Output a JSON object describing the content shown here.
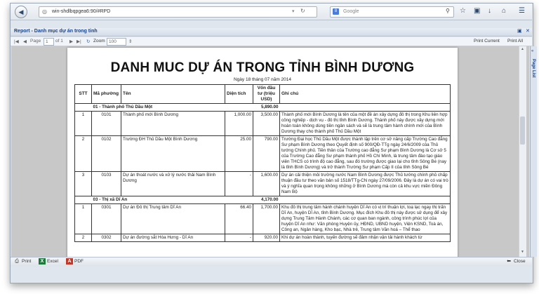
{
  "browser": {
    "url": "win-shdlbqpgea6:90/#RPD",
    "search_placeholder": "Google",
    "search_engine_icon": "google-icon"
  },
  "report_bar": {
    "title": "Report - Danh mục dự án trong tỉnh"
  },
  "toolbar": {
    "page_label": "Page",
    "page_value": "1",
    "of_label": "of 1",
    "zoom_label": "Zoom",
    "zoom_value": "100",
    "print_current": "Print Current",
    "print_all": "Print All"
  },
  "right_panel": {
    "page_list": "Page List"
  },
  "document": {
    "title": "DANH MUC DỰ ÁN TRONG TỈNH BÌNH DƯƠNG",
    "date": "Ngày 18 tháng 07 năm 2014",
    "headers": [
      "STT",
      "Mã phường",
      "Tên",
      "Diện tích",
      "Vốn đầu tư (triệu USD)",
      "Ghi chú"
    ],
    "groups": [
      {
        "name": "01 - Thành phố Thủ Dầu Một",
        "total": "5,890.00",
        "rows": [
          {
            "stt": "1",
            "code": "0101",
            "name": "Thành phố mới Bình Dương",
            "area": "1,000.00",
            "capital": "3,500.00",
            "note": "Thành phố mới Bình Dương là tên của một đề án xây dựng đô thị trong Khu liên hợp công nghiệp - dịch vụ - đô thị tỉnh Bình Dương. Thành phố này được xây dựng mới hoàn toàn không dùng tiền ngân sách và sẽ là trung tâm hành chính mới của Bình Dương thay cho thành phố Thủ Dầu Một"
          },
          {
            "stt": "2",
            "code": "0102",
            "name": "Trường ĐH Thủ Dầu Một Bình Dương",
            "area": "25.00",
            "capital": "790.00",
            "note": "Trường Đại học Thủ Dầu Một được thành lập trên cơ sở nâng cấp Trường Cao đẳng Sư phạm Bình Dương theo Quyết định số 900/QĐ-TTg ngày 24/6/2009 của Thủ tướng Chính phủ. Tiền thân của Trường cao đẳng Sư phạm Bình Dương là Cơ sở 5 của Trường Cao đẳng Sư phạm thành phố Hồ Chí Minh, là trung tâm đào tạo giáo viên THCS có trình độ cao đẳng, sau đó trường được giao lại cho tỉnh Sông Bé (nay là tỉnh Bình Dương) và trở thành Trường Sư phạm Cấp II của tỉnh Sông Bé"
          },
          {
            "stt": "3",
            "code": "0103",
            "name": "Dự án thoát nước và xử lý nước thải Nam Bình Dương",
            "area": "-",
            "capital": "1,600.00",
            "note": "Dự án cải thiện môi trường nước Nam Bình Dương được Thủ tướng chính phủ chấp thuận đầu tư theo văn bản số 1518/TTg-CN ngày 27/09/2006. Đây là dự án có vai trò và ý nghĩa quan trọng không những ở Bình Dương mà còn cả khu vực miền Đông Nam Bộ"
          }
        ]
      },
      {
        "name": "03 - Thị xã Dĩ An",
        "total": "4,170.00",
        "rows": [
          {
            "stt": "1",
            "code": "0301",
            "name": "Dự án Đô thị Trung tâm Dĩ An",
            "area": "66.40",
            "capital": "1,700.00",
            "note": "Khu đô thị trung tâm hành chánh huyện Dĩ An có vị trí thuận lợi, toạ lạc ngay thị trấn Dĩ An, huyện Dĩ An, tỉnh Bình Dương. Mục đích Khu đô thị này được sử dụng để xây dựng Trung Tâm Hành Chánh, các cơ quan ban ngành, công trình phúc lợi của huyện Dĩ An như: Văn phòng Huyện ủy, HĐND, UBND huyện, Viện KSND, Toà án, Công an, Ngân hàng, Kho bạc, Nhà trẻ, Trung tâm Văn hoá – Thể thao"
          },
          {
            "stt": "2",
            "code": "0302",
            "name": "Dự án đường sắt Hòa Hưng - Dĩ An",
            "area": "-",
            "capital": "920.00",
            "note": "Khi dự án hoàn thành, tuyến đường sẽ đảm nhận vận tải hành khách từ"
          }
        ]
      }
    ]
  },
  "bottom_bar": {
    "print": "Print",
    "excel": "Excel",
    "pdf": "PDF",
    "close": "Close"
  }
}
